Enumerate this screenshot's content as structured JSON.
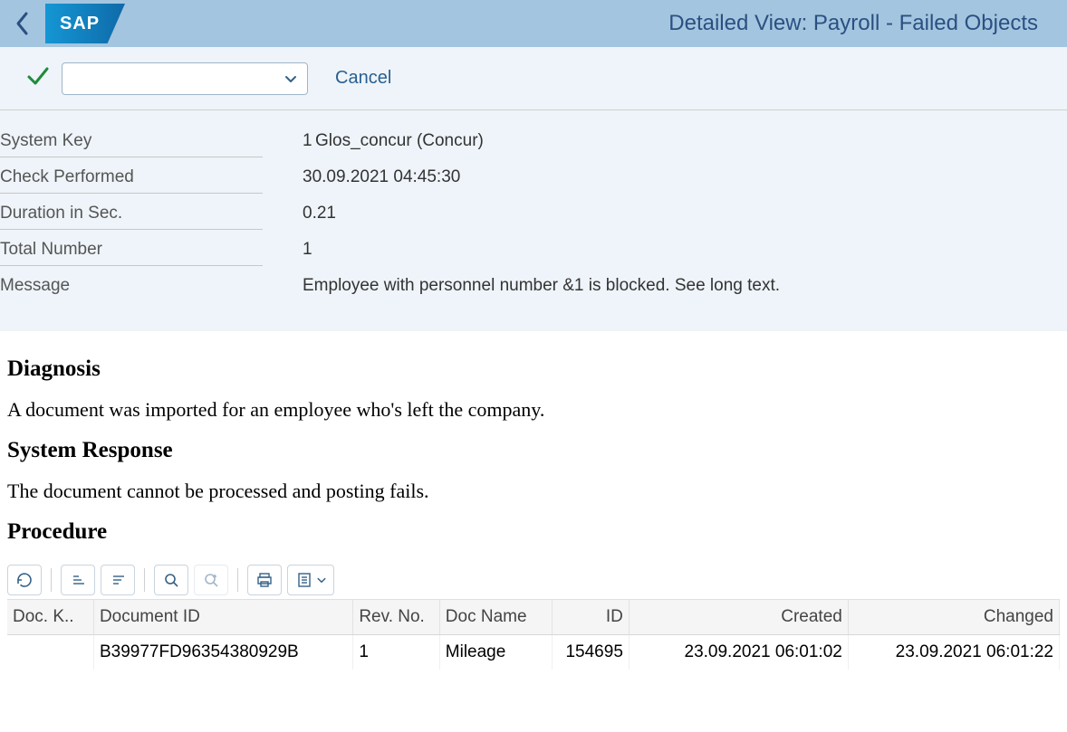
{
  "header": {
    "logo_text": "SAP",
    "title": "Detailed View: Payroll - Failed Objects"
  },
  "toolbar": {
    "cancel_label": "Cancel",
    "combo_value": ""
  },
  "info": {
    "labels": {
      "system_key": "System Key",
      "check_performed": "Check Performed",
      "duration": "Duration in Sec.",
      "total_number": "Total Number",
      "message": "Message"
    },
    "system_key_num": "1",
    "system_key_text": "Glos_concur (Concur)",
    "check_performed": "30.09.2021 04:45:30",
    "duration": "0.21",
    "total_number": "1",
    "message_text": "Employee with personnel number &1 is blocked. See long text."
  },
  "longtext": {
    "diagnosis_h": "Diagnosis",
    "diagnosis_p": "A document was imported for an employee who's left the company.",
    "response_h": "System Response",
    "response_p": "The document cannot be processed and posting fails.",
    "procedure_h": "Procedure"
  },
  "table": {
    "columns": {
      "doc_k": "Doc. K..",
      "doc_id": "Document ID",
      "rev_no": "Rev. No.",
      "doc_name": "Doc Name",
      "id": "ID",
      "created": "Created",
      "changed": "Changed"
    },
    "rows": [
      {
        "doc_k": "",
        "doc_id": "B39977FD96354380929B",
        "rev_no": "1",
        "doc_name": "Mileage",
        "id": "154695",
        "created": "23.09.2021 06:01:02",
        "changed": "23.09.2021 06:01:22"
      }
    ]
  }
}
